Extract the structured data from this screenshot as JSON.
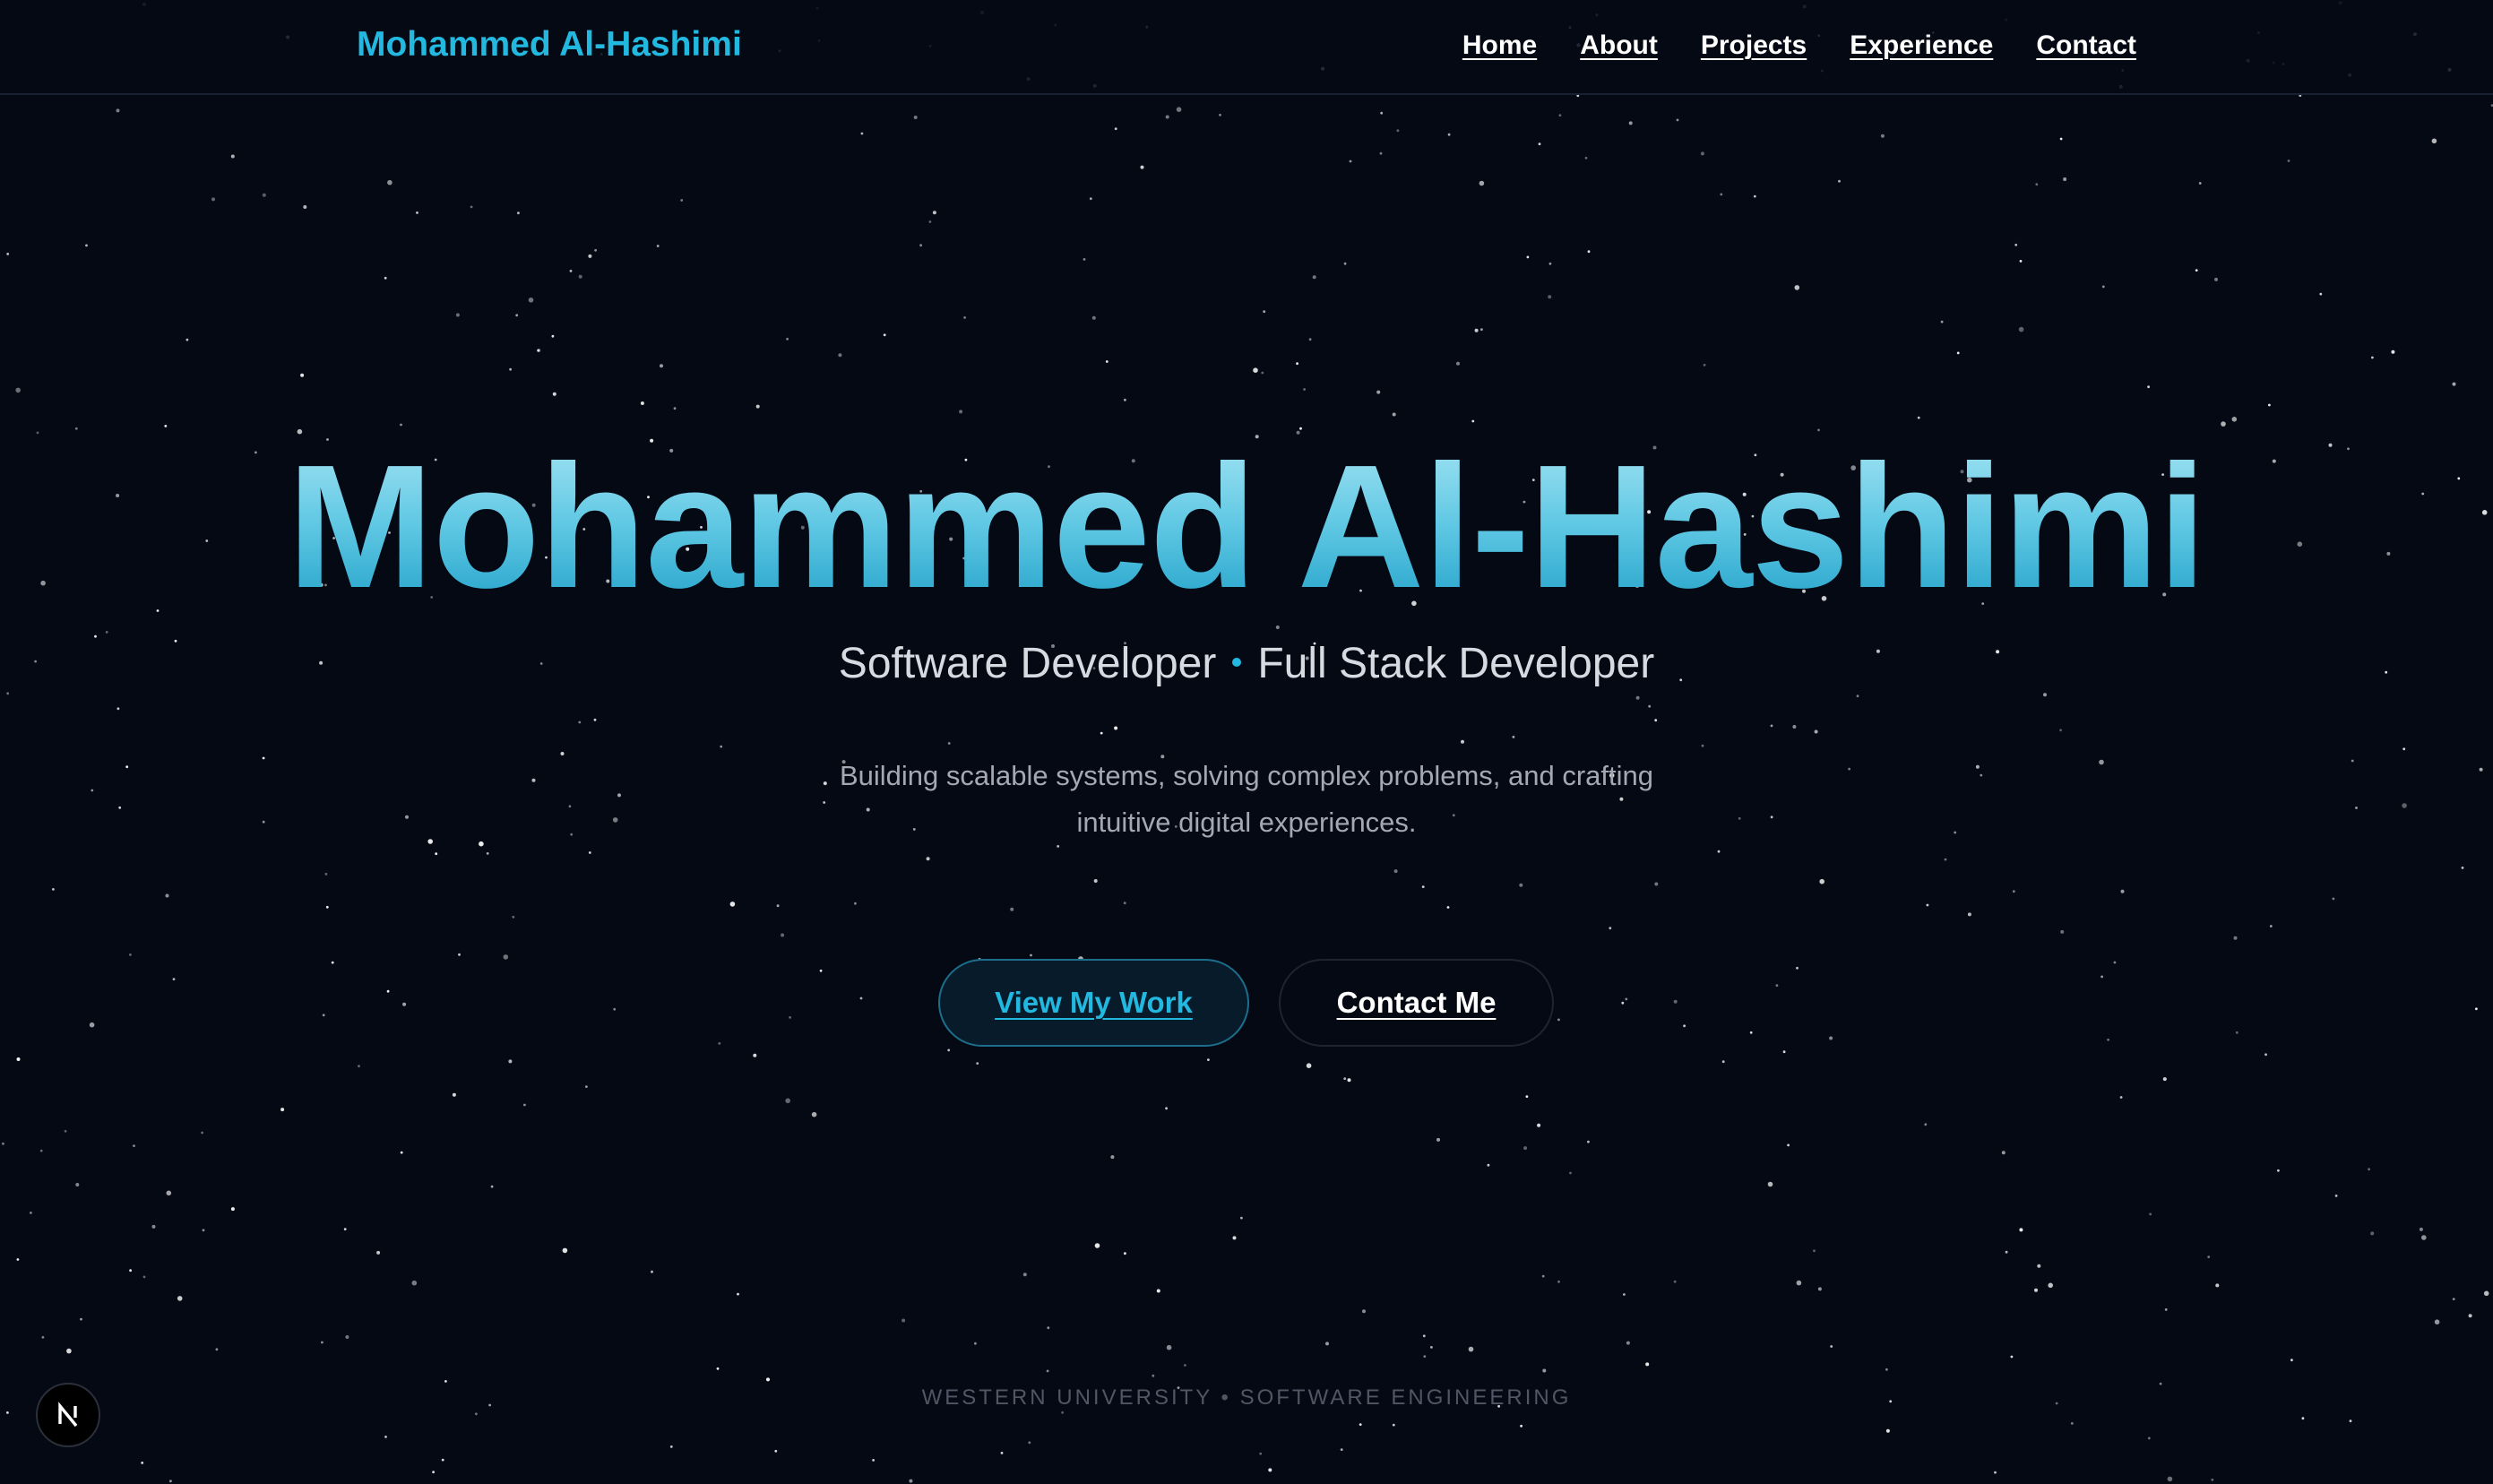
{
  "nav": {
    "brand": "Mohammed Al-Hashimi",
    "links": [
      "Home",
      "About",
      "Projects",
      "Experience",
      "Contact"
    ]
  },
  "hero": {
    "title": "Mohammed Al-Hashimi",
    "role_primary": "Software Developer",
    "role_secondary": "Full Stack Developer",
    "tagline": "Building scalable systems, solving complex problems, and crafting intuitive digital experiences.",
    "primary_button": "View My Work",
    "secondary_button": "Contact Me"
  },
  "footer": {
    "education": "WESTERN UNIVERSITY • SOFTWARE ENGINEERING"
  },
  "badge": {
    "icon": "nextjs-n-icon"
  },
  "colors": {
    "background": "#050914",
    "accent": "#22b8e0",
    "title_gradient_top": "#a9e6f4",
    "title_gradient_bottom": "#1a9cc5",
    "text_muted": "#a3a9b3"
  }
}
